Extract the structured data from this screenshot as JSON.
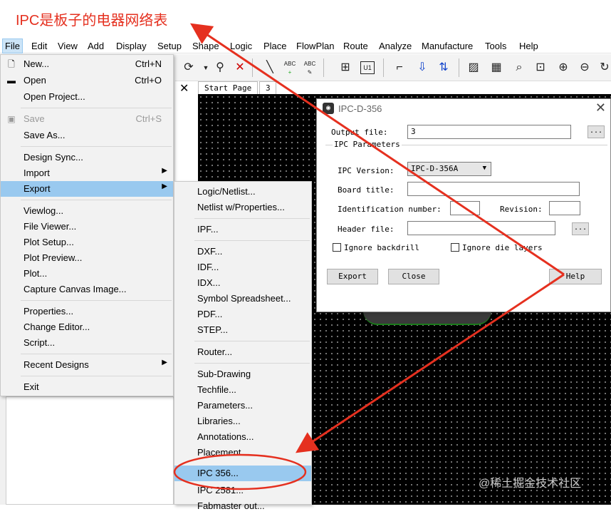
{
  "annotation": {
    "title": "IPC是板子的电器网络表",
    "accent_color": "#e5301f"
  },
  "menubar": {
    "items": [
      "File",
      "Edit",
      "View",
      "Add",
      "Display",
      "Setup",
      "Shape",
      "Logic",
      "Place",
      "FlowPlan",
      "Route",
      "Analyze",
      "Manufacture",
      "Tools",
      "Help"
    ],
    "active": "File"
  },
  "toolbar": {
    "icons": [
      "redo-icon",
      "dropdown-arrow-icon",
      "pin-icon",
      "delete-icon",
      "add-line-icon",
      "text-abc-icon",
      "edit-text-icon",
      "place-component-icon",
      "component-u-icon",
      "connect-icon",
      "import-icon",
      "swap-pins-icon",
      "drc-icon",
      "grid-icon",
      "zoom-search-icon",
      "zoom-fit-icon",
      "zoom-in-icon",
      "zoom-out-icon",
      "refresh-icon"
    ],
    "labels": {
      "abc1": "ABC",
      "abc2": "ABC",
      "u1": "U1"
    }
  },
  "tabs": {
    "close_label": "✕",
    "start_page": "Start Page",
    "design_tab": "3"
  },
  "file_menu": {
    "items": [
      {
        "label": "New...",
        "shortcut": "Ctrl+N"
      },
      {
        "label": "Open",
        "shortcut": "Ctrl+O"
      },
      {
        "label": "Open Project..."
      },
      {
        "label": "Save",
        "shortcut": "Ctrl+S",
        "disabled": true
      },
      {
        "label": "Save As..."
      },
      {
        "label": "Design Sync..."
      },
      {
        "label": "Import",
        "submenu": true
      },
      {
        "label": "Export",
        "submenu": true,
        "highlighted": true
      },
      {
        "label": "Viewlog..."
      },
      {
        "label": "File Viewer..."
      },
      {
        "label": "Plot Setup..."
      },
      {
        "label": "Plot Preview..."
      },
      {
        "label": "Plot..."
      },
      {
        "label": "Capture Canvas Image..."
      },
      {
        "label": "Properties..."
      },
      {
        "label": "Change Editor..."
      },
      {
        "label": "Script..."
      },
      {
        "label": "Recent Designs",
        "submenu": true
      },
      {
        "label": "Exit"
      }
    ]
  },
  "export_menu": {
    "items": [
      {
        "label": "Logic/Netlist..."
      },
      {
        "label": "Netlist w/Properties..."
      },
      {
        "label": "IPF..."
      },
      {
        "label": "DXF..."
      },
      {
        "label": "IDF..."
      },
      {
        "label": "IDX..."
      },
      {
        "label": "Symbol Spreadsheet..."
      },
      {
        "label": "PDF..."
      },
      {
        "label": "STEP..."
      },
      {
        "label": "Router..."
      },
      {
        "label": "Sub-Drawing"
      },
      {
        "label": "Techfile..."
      },
      {
        "label": "Parameters..."
      },
      {
        "label": "Libraries..."
      },
      {
        "label": "Annotations..."
      },
      {
        "label": "Placement..."
      },
      {
        "label": "IPC 356...",
        "highlighted": true
      },
      {
        "label": "IPC 2581..."
      },
      {
        "label": "Fabmaster out..."
      }
    ]
  },
  "dialog": {
    "title": "IPC-D-356",
    "close_label": "✕",
    "output_file_label": "Output file:",
    "output_file_value": "3",
    "browse_label": "...",
    "group_label": "IPC Parameters",
    "ipc_version_label": "IPC Version:",
    "ipc_version_value": "IPC-D-356A",
    "board_title_label": "Board title:",
    "board_title_value": "",
    "identification_label": "Identification number:",
    "identification_value": "",
    "revision_label": "Revision:",
    "revision_value": "",
    "header_file_label": "Header file:",
    "header_file_value": "",
    "ignore_backdrill_label": "Ignore backdrill",
    "ignore_die_layers_label": "Ignore die layers",
    "export_button": "Export",
    "close_button": "Close",
    "help_button": "Help"
  },
  "watermark": "@稀土掘金技术社区"
}
